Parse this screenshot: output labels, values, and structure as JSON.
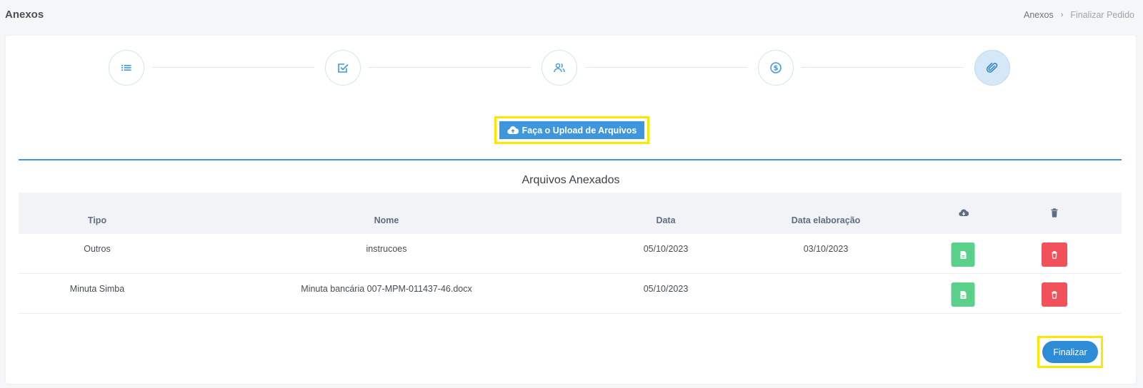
{
  "header": {
    "title": "Anexos",
    "breadcrumb": [
      "Anexos",
      "Finalizar Pedido"
    ]
  },
  "stepper": {
    "steps": [
      {
        "icon": "list-icon",
        "active": false
      },
      {
        "icon": "checkbox-icon",
        "active": false
      },
      {
        "icon": "users-icon",
        "active": false
      },
      {
        "icon": "dollar-icon",
        "active": false
      },
      {
        "icon": "paperclip-icon",
        "active": true
      }
    ]
  },
  "upload": {
    "label": "Faça o Upload de Arquivos",
    "icon": "cloud-upload-icon"
  },
  "attachments": {
    "title": "Arquivos Anexados",
    "columns": [
      "Tipo",
      "Nome",
      "Data",
      "Data elaboração"
    ],
    "action_icons": [
      "cloud-download-icon",
      "trash-icon"
    ],
    "rows": [
      {
        "tipo": "Outros",
        "nome": "instrucoes",
        "data": "05/10/2023",
        "data_elaboracao": "03/10/2023"
      },
      {
        "tipo": "Minuta Simba",
        "nome": "Minuta bancária 007-MPM-011437-46.docx",
        "data": "05/10/2023",
        "data_elaboracao": ""
      }
    ]
  },
  "finalize": {
    "label": "Finalizar"
  },
  "colors": {
    "accent": "#3e97dc",
    "success": "#5bd08a",
    "danger": "#f2505a",
    "highlight": "#ffe600"
  }
}
